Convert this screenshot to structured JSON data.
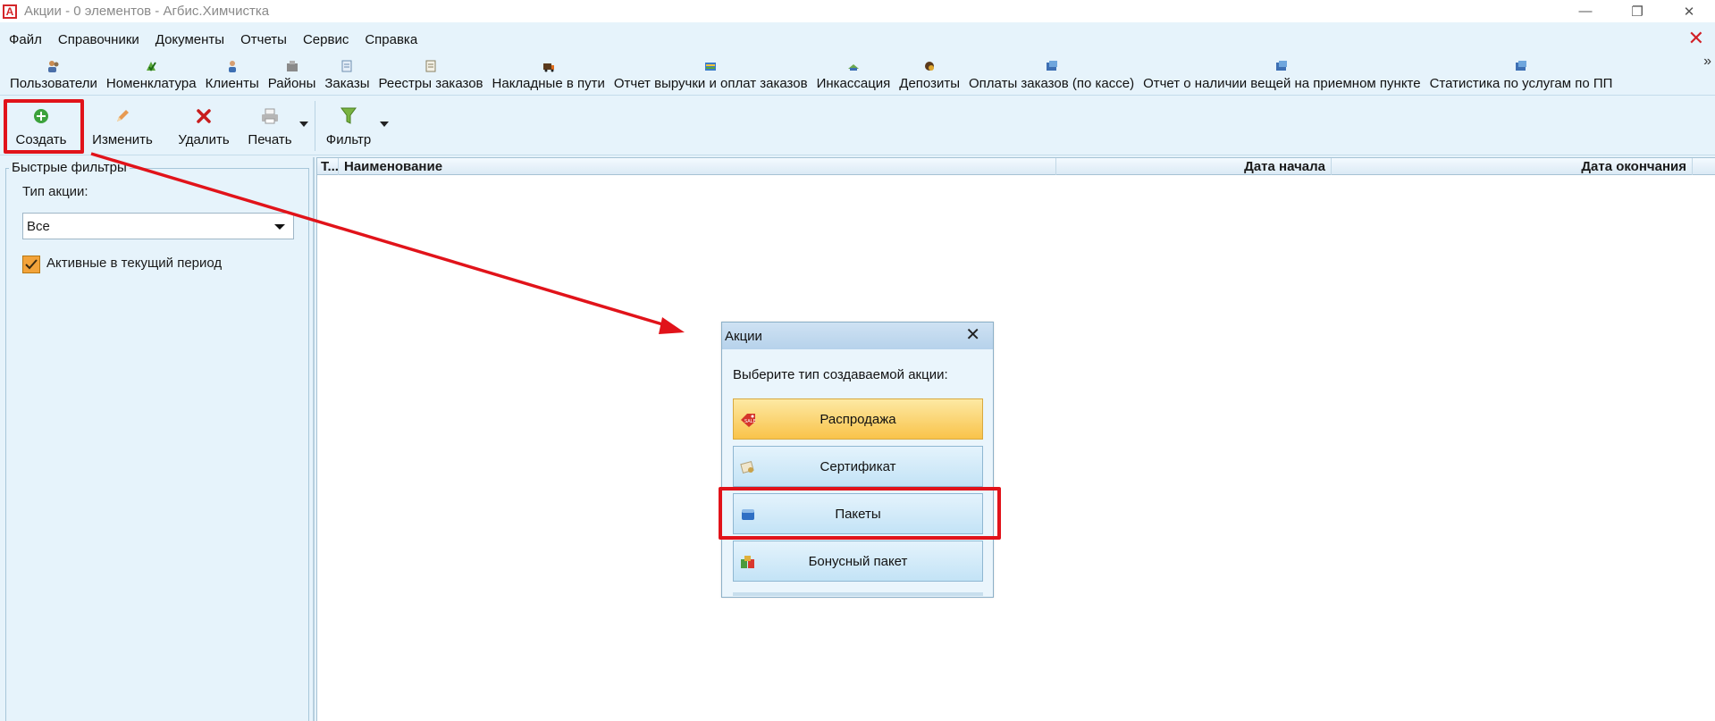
{
  "window": {
    "title": "Акции - 0 элементов - Агбис.Химчистка",
    "logo_letter": "A",
    "controls": {
      "minimize": "—",
      "maximize": "❐",
      "close": "✕"
    }
  },
  "menu": [
    "Файл",
    "Справочники",
    "Документы",
    "Отчеты",
    "Сервис",
    "Справка"
  ],
  "shortcuts": [
    {
      "label": "Пользователи",
      "icon": "users-icon"
    },
    {
      "label": "Номенклатура",
      "icon": "nomenclature-icon"
    },
    {
      "label": "Клиенты",
      "icon": "client-icon"
    },
    {
      "label": "Районы",
      "icon": "district-icon"
    },
    {
      "label": "Заказы",
      "icon": "orders-icon"
    },
    {
      "label": "Реестры заказов",
      "icon": "registry-icon"
    },
    {
      "label": "Накладные в пути",
      "icon": "waybill-icon"
    },
    {
      "label": "Отчет выручки и оплат заказов",
      "icon": "revenue-report-icon"
    },
    {
      "label": "Инкассация",
      "icon": "collection-icon"
    },
    {
      "label": "Депозиты",
      "icon": "deposit-icon"
    },
    {
      "label": "Оплаты заказов (по кассе)",
      "icon": "payments-icon"
    },
    {
      "label": "Отчет о наличии вещей на приемном пункте",
      "icon": "availability-report-icon"
    },
    {
      "label": "Статистика по услугам по ПП",
      "icon": "statistics-icon"
    }
  ],
  "shortcuts_more": "»",
  "toolbar": {
    "create": "Создать",
    "edit": "Изменить",
    "delete": "Удалить",
    "print": "Печать",
    "filter": "Фильтр"
  },
  "quick_filters": {
    "title": "Быстрые фильтры",
    "type_label": "Тип акции:",
    "type_value": "Все",
    "active_label": "Активные в текущий период",
    "active_checked": true
  },
  "grid": {
    "columns": [
      "Т...",
      "Наименование",
      "Дата начала",
      "Дата окончания"
    ]
  },
  "dialog": {
    "title": "Акции",
    "close": "✕",
    "prompt": "Выберите тип создаваемой акции:",
    "options": [
      "Распродажа",
      "Сертификат",
      "Пакеты",
      "Бонусный пакет"
    ]
  },
  "colors": {
    "highlight": "#e1131a",
    "accent_red": "#d11f26",
    "panel_bg": "#e6f3fb",
    "primary_button": "#f9c34a"
  }
}
